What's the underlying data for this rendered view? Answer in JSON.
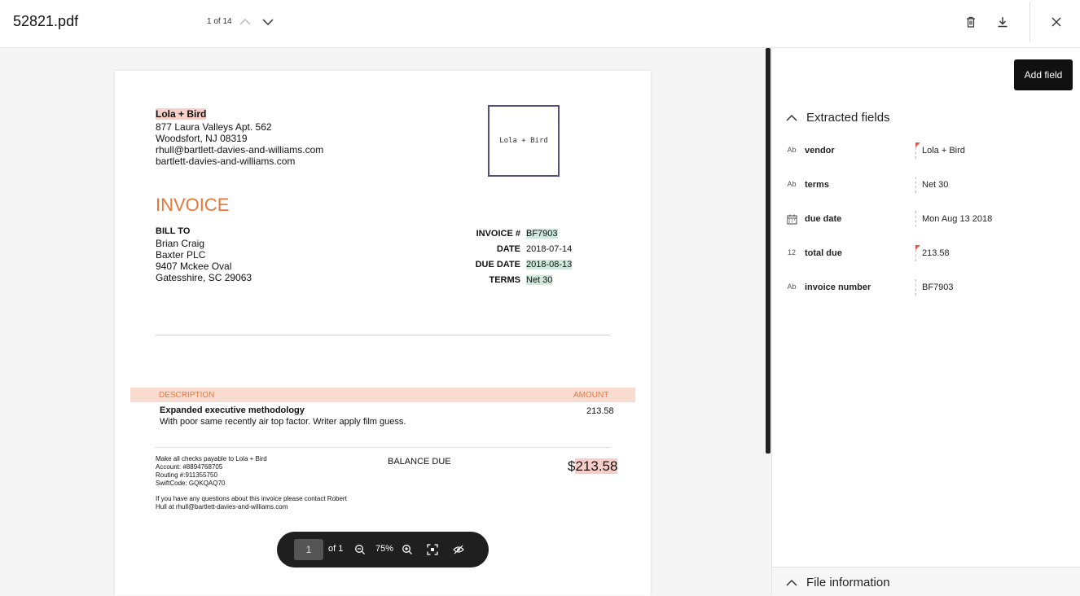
{
  "header": {
    "file_name": "52821.pdf",
    "page_counter": "1 of 14",
    "icons": [
      "chevron-up-icon",
      "chevron-down-icon",
      "trash-icon",
      "download-icon",
      "close-icon"
    ]
  },
  "document": {
    "vendor_name": "Lola + Bird",
    "vendor_address": [
      "877 Laura Valleys Apt. 562",
      "Woodsfort, NJ 08319",
      "rhull@bartlett-davies-and-williams.com",
      "bartlett-davies-and-williams.com"
    ],
    "logo_text": "Lola + Bird",
    "heading": "INVOICE",
    "bill_to_label": "BILL TO",
    "bill_to": [
      "Brian Craig",
      "Baxter PLC",
      "9407 Mckee Oval",
      "Gatesshire, SC 29063"
    ],
    "meta": {
      "invoice_label": "INVOICE #",
      "invoice_value": "BF7903",
      "date_label": "DATE",
      "date_value": "2018-07-14",
      "due_label": "DUE DATE",
      "due_value": "2018-08-13",
      "terms_label": "TERMS",
      "terms_value": "Net 30"
    },
    "table": {
      "desc_header": "DESCRIPTION",
      "amount_header": "AMOUNT",
      "item_title": "Expanded executive methodology",
      "item_desc": "With poor same recently air top factor. Writer apply film guess.",
      "item_amount": "213.58"
    },
    "payment": [
      "Make all checks payable to Lola + Bird",
      "Account: #8894768705",
      "Routing #:911355750",
      "SwiftCode: GQKQAQ70"
    ],
    "contact": [
      "If you have any questions about this invoice please contact Robert",
      "Hull at rhull@bartlett-davies-and-williams.com"
    ],
    "balance_label": "BALANCE DUE",
    "balance_currency": "$",
    "balance_value": "213.58"
  },
  "zoom_bar": {
    "page_input": "1",
    "of_label": "of 1",
    "zoom_level": "75%",
    "icons": [
      "zoom-out-icon",
      "zoom-in-icon",
      "fit-screen-icon",
      "hide-highlights-icon"
    ]
  },
  "panel": {
    "add_field_label": "Add field",
    "extracted_title": "Extracted fields",
    "fields": [
      {
        "type": "Ab",
        "name": "vendor",
        "value": "Lola + Bird",
        "flag": true
      },
      {
        "type": "Ab",
        "name": "terms",
        "value": "Net 30",
        "flag": false
      },
      {
        "type": "calendar-icon",
        "name": "due date",
        "value": "Mon Aug 13 2018",
        "flag": false
      },
      {
        "type": "12",
        "name": "total due",
        "value": "213.58",
        "flag": true
      },
      {
        "type": "Ab",
        "name": "invoice number",
        "value": "BF7903",
        "flag": false
      }
    ],
    "file_info_title": "File information"
  },
  "colors": {
    "accent_orange": "#e8773a",
    "highlight_red": "#f7cfc9",
    "highlight_green": "#cfe8dc",
    "flag_red": "#e05548",
    "logo_border": "#554c7a"
  }
}
